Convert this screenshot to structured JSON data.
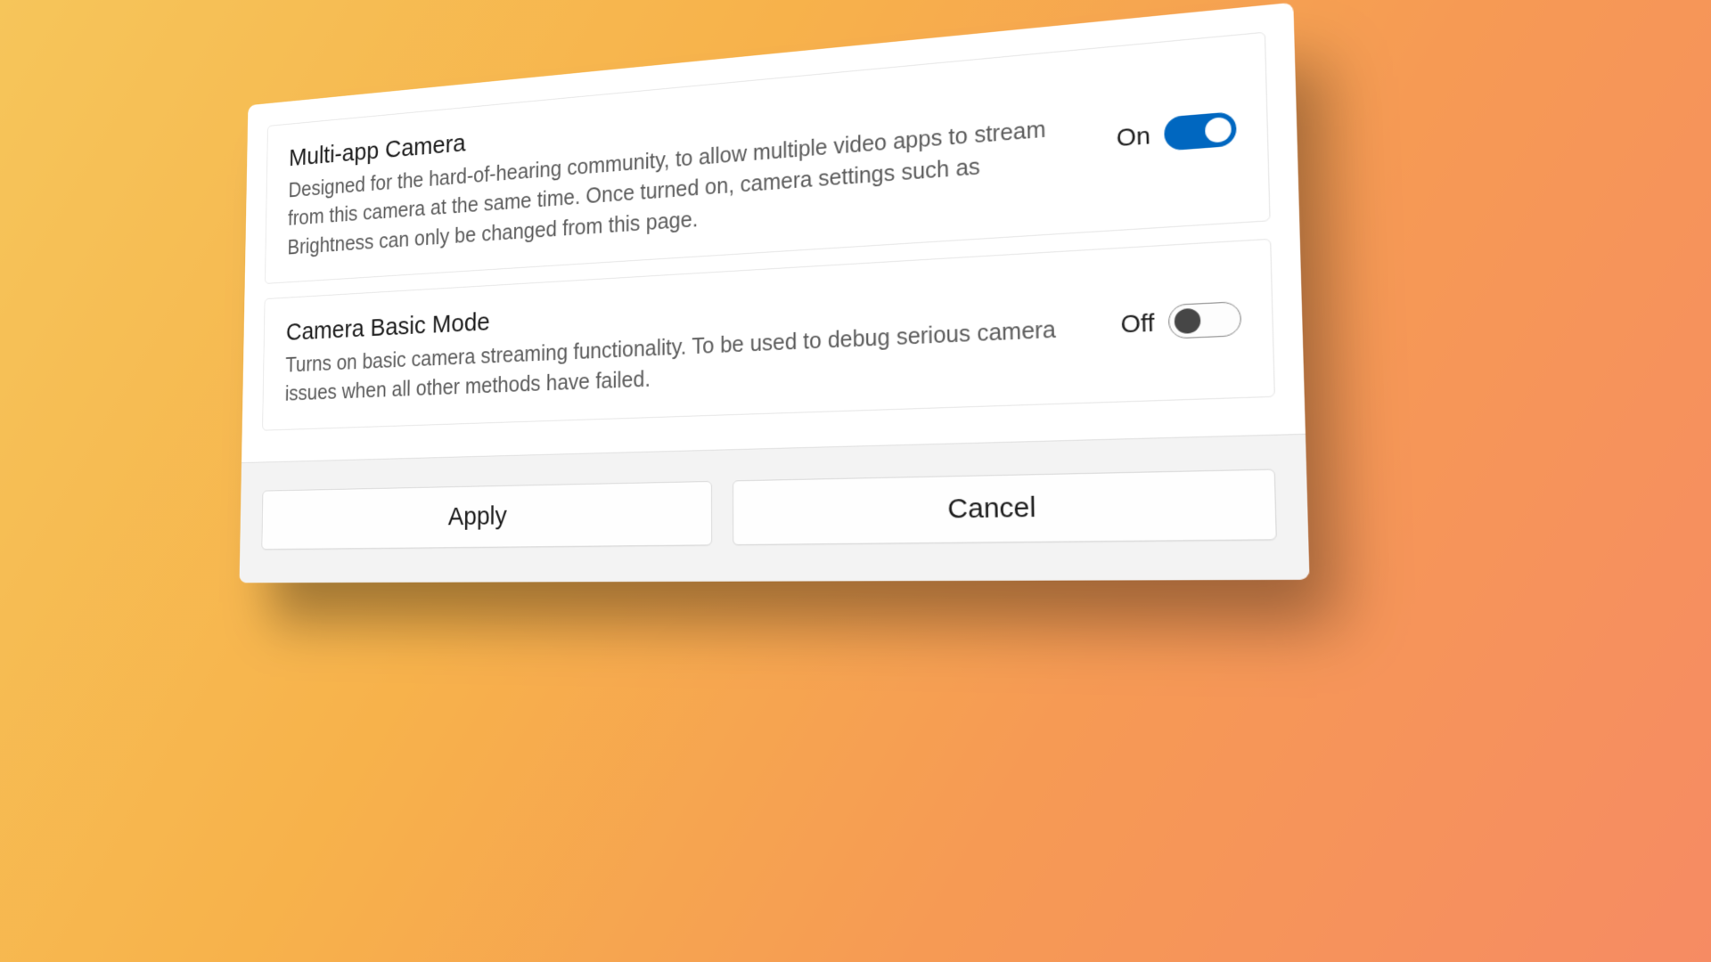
{
  "settings": [
    {
      "title": "Multi-app Camera",
      "description": "Designed for the hard-of-hearing community, to allow multiple video apps to stream from this camera at the same time. Once turned on, camera settings such as Brightness can only be changed from this page.",
      "state_label": "On",
      "on": true
    },
    {
      "title": "Camera Basic Mode",
      "description": "Turns on basic camera streaming functionality. To be used to debug serious camera issues when all other methods have failed.",
      "state_label": "Off",
      "on": false
    }
  ],
  "footer": {
    "apply_label": "Apply",
    "cancel_label": "Cancel"
  },
  "colors": {
    "accent": "#0067c0"
  }
}
